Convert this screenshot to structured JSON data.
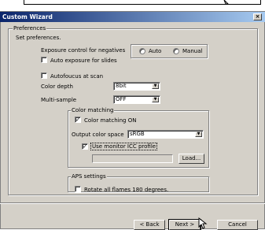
{
  "window": {
    "title": "Custom Wizard",
    "close": "×"
  },
  "preferences": {
    "group_label": "Preferences",
    "set_label": "Set preferences.",
    "exposure_label": "Exposure control for negatives",
    "radio_auto": "Auto",
    "radio_manual": "Manual",
    "auto_exposure_slides": "Auto exposure for slides",
    "autofocus_at_scan": "Autofoucus at scan",
    "color_depth_label": "Color depth",
    "color_depth_value": "8bit",
    "multi_sample_label": "Multi-sample",
    "multi_sample_value": "OFF"
  },
  "color_matching": {
    "group_label": "Color matching",
    "on_label": "Color matching ON",
    "on_checked": "✓",
    "output_space_label": "Output color space",
    "output_space_value": "sRGB",
    "monitor_icc_label": "Use monitor ICC profile",
    "monitor_icc_checked": "✓",
    "load_button": "Load..."
  },
  "aps": {
    "group_label": "APS settings",
    "rotate_label": "Rotate all flames 180 degrees."
  },
  "footer": {
    "back": "< Back",
    "next": "Next >",
    "cancel": "Cancel"
  }
}
